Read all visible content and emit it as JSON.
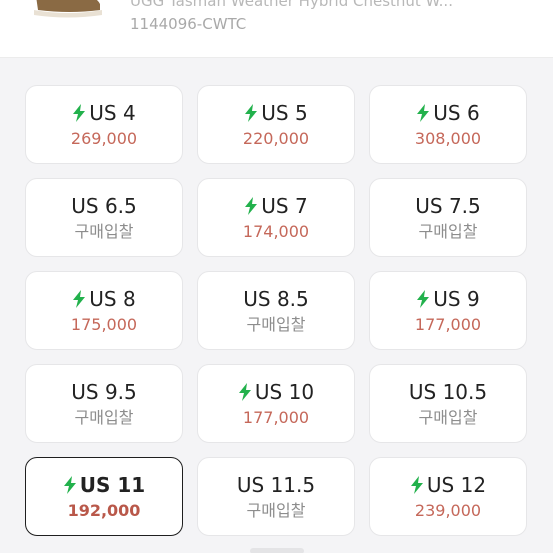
{
  "product": {
    "name": "UGG Tasman Weather Hybrid Chestnut W...",
    "code": "1144096-CWTC"
  },
  "colors": {
    "accent_green": "#22b14c",
    "price_red": "#c5685a",
    "bid_gray": "#8d8d8d"
  },
  "sizes": [
    {
      "label": "US 4",
      "price": "269,000",
      "fast": true
    },
    {
      "label": "US 5",
      "price": "220,000",
      "fast": true
    },
    {
      "label": "US 6",
      "price": "308,000",
      "fast": true
    },
    {
      "label": "US 6.5",
      "price": "구매입찰",
      "fast": false
    },
    {
      "label": "US 7",
      "price": "174,000",
      "fast": true
    },
    {
      "label": "US 7.5",
      "price": "구매입찰",
      "fast": false
    },
    {
      "label": "US 8",
      "price": "175,000",
      "fast": true
    },
    {
      "label": "US 8.5",
      "price": "구매입찰",
      "fast": false
    },
    {
      "label": "US 9",
      "price": "177,000",
      "fast": true
    },
    {
      "label": "US 9.5",
      "price": "구매입찰",
      "fast": false
    },
    {
      "label": "US 10",
      "price": "177,000",
      "fast": true
    },
    {
      "label": "US 10.5",
      "price": "구매입찰",
      "fast": false
    },
    {
      "label": "US 11",
      "price": "192,000",
      "fast": true,
      "selected": true
    },
    {
      "label": "US 11.5",
      "price": "구매입찰",
      "fast": false
    },
    {
      "label": "US 12",
      "price": "239,000",
      "fast": true
    }
  ]
}
